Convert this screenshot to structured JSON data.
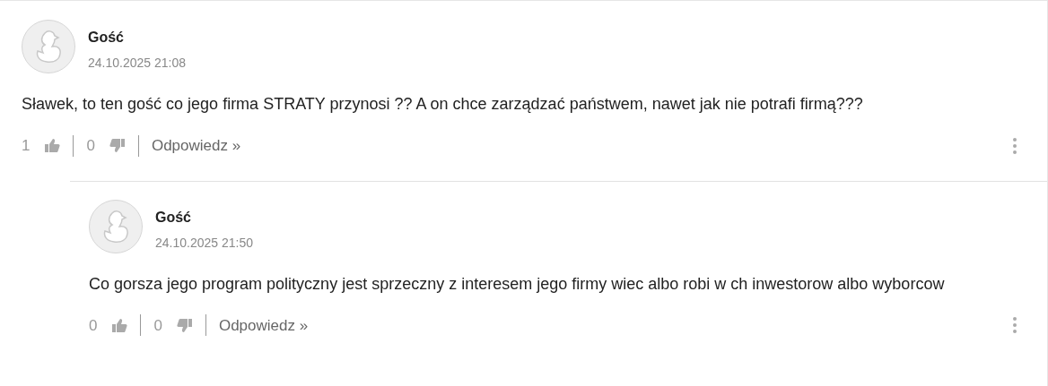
{
  "comments": [
    {
      "author": "Gość",
      "date": "24.10.2025 21:08",
      "text": "Sławek, to ten gość co jego firma STRATY przynosi ?? A on chce zarządzać państwem, nawet jak nie potrafi firmą???",
      "likes": "1",
      "dislikes": "0",
      "reply_label": "Odpowiedz »",
      "children": [
        {
          "author": "Gość",
          "date": "24.10.2025 21:50",
          "text": "Co gorsza jego program polityczny jest sprzeczny z interesem jego firmy wiec albo robi w ch inwestorow albo wyborcow",
          "likes": "0",
          "dislikes": "0",
          "reply_label": "Odpowiedz »"
        }
      ]
    }
  ]
}
